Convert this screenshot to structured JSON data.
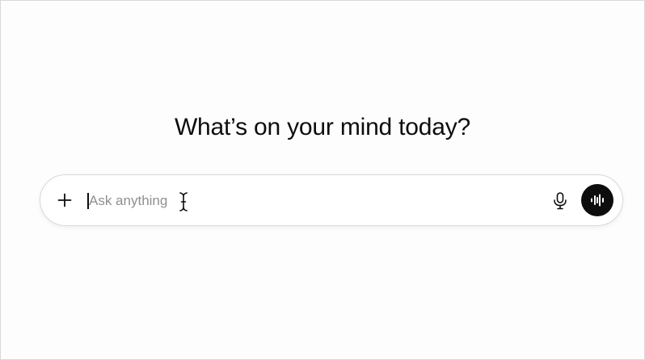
{
  "main": {
    "heading": "What’s on your mind today?"
  },
  "composer": {
    "placeholder": "Ask anything",
    "value": "",
    "add_icon": "plus-icon",
    "mic_icon": "microphone-icon",
    "voice_icon": "voice-mode-icon"
  },
  "colors": {
    "background": "#fdfdfd",
    "text": "#0d0d0d",
    "placeholder": "#8f8f8f",
    "voice_button": "#0d0d0d"
  }
}
